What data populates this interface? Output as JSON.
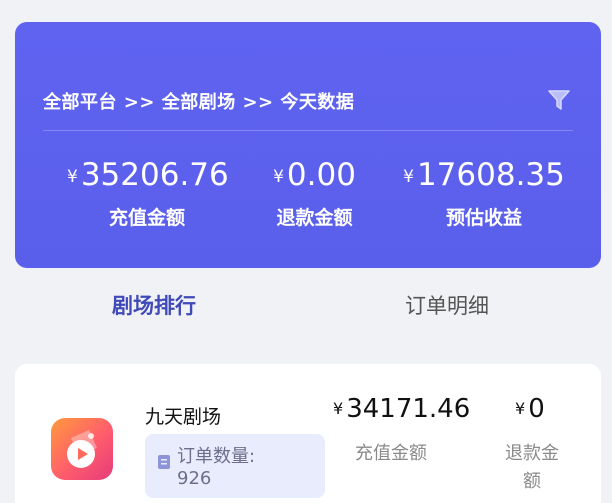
{
  "summary": {
    "breadcrumb": "全部平台 >> 全部剧场 >> 今天数据",
    "filter_icon": "filter-icon",
    "stats": [
      {
        "currency": "¥",
        "amount": "35206.76",
        "label": "充值金额"
      },
      {
        "currency": "¥",
        "amount": "0.00",
        "label": "退款金额"
      },
      {
        "currency": "¥",
        "amount": "17608.35",
        "label": "预估收益"
      }
    ]
  },
  "tabs": [
    {
      "label": "剧场排行",
      "active": true
    },
    {
      "label": "订单明细",
      "active": false
    }
  ],
  "theater": {
    "name": "九天剧场",
    "icon": "app-logo-icon",
    "order_label": "订单数量:",
    "order_count": "926",
    "recharge": {
      "currency": "¥",
      "amount": "34171.46",
      "label": "充值金额"
    },
    "refund": {
      "currency": "¥",
      "amount": "0",
      "label_line1": "退款金",
      "label_line2": "额"
    }
  },
  "colors": {
    "accent": "#5f63f0",
    "active_tab": "#3f49b8",
    "background": "#f1f2f6"
  }
}
